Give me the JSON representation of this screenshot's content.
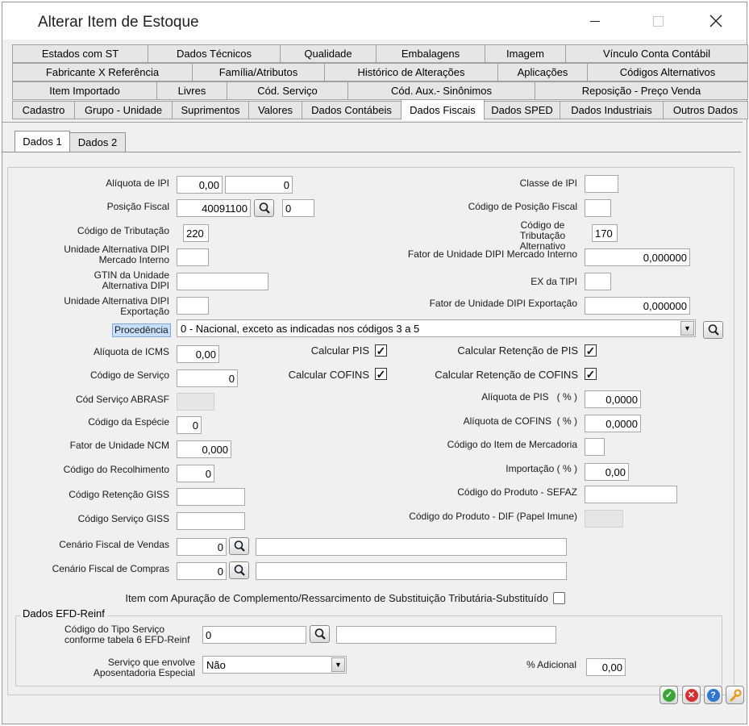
{
  "window": {
    "title": "Alterar Item de Estoque"
  },
  "tabs": {
    "row1": [
      "Estados com ST",
      "Dados Técnicos",
      "Qualidade",
      "Embalagens",
      "Imagem",
      "Vínculo Conta Contábil"
    ],
    "row2": [
      "Fabricante X Referência",
      "Família/Atributos",
      "Histórico de Alterações",
      "Aplicações",
      "Códigos Alternativos"
    ],
    "row3": [
      "Item Importado",
      "Livres",
      "Cód. Serviço",
      "Cód. Aux.- Sinônimos",
      "Reposição - Preço Venda"
    ],
    "row4": [
      "Cadastro",
      "Grupo - Unidade",
      "Suprimentos",
      "Valores",
      "Dados Contábeis",
      "Dados Fiscais",
      "Dados SPED",
      "Dados Industriais",
      "Outros Dados"
    ],
    "active": "Dados Fiscais"
  },
  "subtabs": [
    "Dados 1",
    "Dados 2"
  ],
  "left": {
    "aliquota_ipi": {
      "label": "Alíquota de IPI",
      "value1": "0,00",
      "value2": "0"
    },
    "posicao_fiscal": {
      "label": "Posição Fiscal",
      "value": "40091100",
      "value2": "0"
    },
    "codigo_tributacao": {
      "label": "Código de Tributação",
      "value": "220"
    },
    "unid_alt_dipi_mi": {
      "label1": "Unidade Alternativa DIPI",
      "label2": "Mercado Interno",
      "value": ""
    },
    "gtin_unid_alt": {
      "label1": "GTIN da Unidade",
      "label2": "Alternativa DIPI",
      "value": ""
    },
    "unid_alt_dipi_exp": {
      "label1": "Unidade Alternativa DIPI",
      "label2": "Exportação",
      "value": ""
    },
    "procedencia": {
      "label": "Procedência",
      "value": "0 - Nacional, exceto as indicadas nos códigos 3 a 5"
    },
    "aliquota_icms": {
      "label": "Alíquota de ICMS",
      "value": "0,00"
    },
    "codigo_servico": {
      "label": "Código de Serviço",
      "value": "0"
    },
    "cod_servico_abrasf": {
      "label": "Cód Serviço ABRASF",
      "value": ""
    },
    "codigo_especie": {
      "label": "Código da Espécie",
      "value": "0"
    },
    "fator_unidade_ncm": {
      "label": "Fator de Unidade NCM",
      "value": "0,000"
    },
    "codigo_recolhimento": {
      "label": "Código do Recolhimento",
      "value": "0"
    },
    "codigo_retencao_giss": {
      "label": "Código Retenção GISS",
      "value": ""
    },
    "codigo_servico_giss": {
      "label": "Código Serviço GISS",
      "value": ""
    },
    "cenario_vendas": {
      "label": "Cenário Fiscal de Vendas",
      "value": "0",
      "desc": ""
    },
    "cenario_compras": {
      "label": "Cenário Fiscal de Compras",
      "value": "0",
      "desc": ""
    }
  },
  "right": {
    "classe_ipi": {
      "label": "Classe de IPI",
      "value": ""
    },
    "codigo_posicao_fiscal": {
      "label": "Código de Posição Fiscal",
      "value": ""
    },
    "codigo_trib_alt": {
      "label1": "Código de Tributação",
      "label2": "Alternativo",
      "value": "170"
    },
    "fator_dipi_mi": {
      "label": "Fator de Unidade DIPI Mercado Interno",
      "value": "0,000000"
    },
    "ex_tipi": {
      "label": "EX da TIPI",
      "value": ""
    },
    "fator_dipi_exp": {
      "label": "Fator de Unidade DIPI Exportação",
      "value": "0,000000"
    },
    "calc_ret_pis": {
      "label": "Calcular Retenção de PIS",
      "checked": true
    },
    "calc_ret_cofins": {
      "label": "Calcular Retenção de COFINS",
      "checked": true
    },
    "aliquota_pis": {
      "label": "Alíquota de PIS   ( % )",
      "value": "0,0000"
    },
    "aliquota_cofins": {
      "label": "Alíquota de COFINS  ( % )",
      "value": "0,0000"
    },
    "codigo_item_mercadoria": {
      "label": "Código do Item de Mercadoria",
      "value": ""
    },
    "importacao": {
      "label": "Importação  ( % )",
      "value": "0,00"
    },
    "codigo_produto_sefaz": {
      "label": "Código do Produto - SEFAZ",
      "value": ""
    },
    "codigo_produto_dif": {
      "label": "Código do Produto - DIF (Papel Imune)",
      "value": ""
    }
  },
  "middle": {
    "calc_pis": {
      "label": "Calcular PIS",
      "checked": true
    },
    "calc_cofins": {
      "label": "Calcular COFINS",
      "checked": true
    }
  },
  "apuracao": {
    "label": "Item com Apuração de Complemento/Ressarcimento de Substituição Tributária-Substituído",
    "checked": false
  },
  "efd": {
    "title": "Dados EFD-Reinf",
    "tipo_servico": {
      "label1": "Código do Tipo Serviço",
      "label2": "conforme tabela 6 EFD-Reinf",
      "value": "0",
      "desc": ""
    },
    "aposentadoria": {
      "label1": "Serviço que envolve",
      "label2": "Aposentadoria Especial",
      "value": "Não"
    },
    "adicional": {
      "label": "% Adicional",
      "value": "0,00"
    }
  },
  "actions": {
    "ok_icon": "check-icon",
    "cancel_icon": "x-icon",
    "help_icon": "question-icon",
    "tools_icon": "wrench-icon",
    "ok_color": "#3aa63a",
    "cancel_color": "#d83030",
    "help_color": "#2f78d0",
    "tools_color": "#f0a020"
  }
}
